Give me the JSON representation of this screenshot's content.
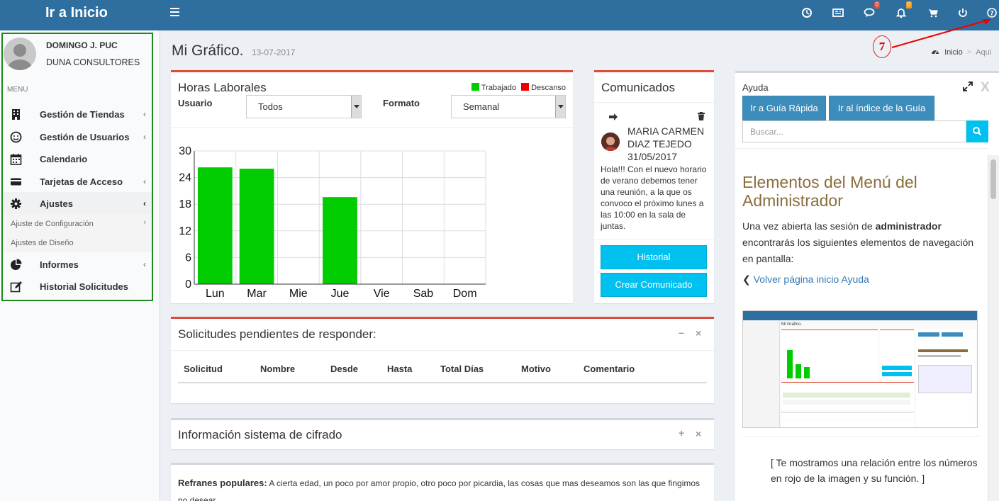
{
  "header": {
    "title": "Ir a Inicio",
    "badges": {
      "messages": "0",
      "notifications": "0"
    }
  },
  "sidebar": {
    "user_name": "DOMINGO J. PUC",
    "user_company": "DUNA CONSULTORES",
    "menu_header": "MENU",
    "items": [
      {
        "label": "Gestión de Tiendas",
        "icon": "building-icon"
      },
      {
        "label": "Gestión de Usuarios",
        "icon": "smile-icon"
      },
      {
        "label": "Calendario",
        "icon": "calendar-icon"
      },
      {
        "label": "Tarjetas de Acceso",
        "icon": "card-icon"
      },
      {
        "label": "Ajustes",
        "icon": "gear-icon"
      },
      {
        "label": "Informes",
        "icon": "pie-chart-icon"
      },
      {
        "label": "Historial Solicitudes",
        "icon": "edit-icon"
      }
    ],
    "submenu": [
      {
        "label": "Ajuste de Configuración"
      },
      {
        "label": "Ajustes de Diseño"
      }
    ]
  },
  "page": {
    "title": "Mi Gráfico.",
    "date": "13-07-2017",
    "breadcrumb_home": "Inicio",
    "breadcrumb_current": "Aqui",
    "callout_number": "7"
  },
  "horas": {
    "title": "Horas Laborales",
    "legend_worked": "Trabajado",
    "legend_rest": "Descanso",
    "usuario_label": "Usuario",
    "usuario_value": "Todos",
    "formato_label": "Formato",
    "formato_value": "Semanal"
  },
  "chart_data": {
    "type": "bar",
    "categories": [
      "Lun",
      "Mar",
      "Mie",
      "Jue",
      "Vie",
      "Sab",
      "Dom"
    ],
    "series": [
      {
        "name": "Trabajado",
        "values": [
          26.3,
          26.0,
          0,
          19.6,
          0,
          0,
          0
        ],
        "color": "#00cc00"
      },
      {
        "name": "Descanso",
        "values": [
          0,
          0,
          0,
          0,
          0,
          0,
          0
        ],
        "color": "#ee0000"
      }
    ],
    "ylim": [
      0,
      30
    ],
    "yticks": [
      0,
      6,
      12,
      18,
      24,
      30
    ],
    "grid": true,
    "legend": "top-right"
  },
  "comunicados": {
    "title": "Comunicados",
    "author": "MARIA CARMEN DIAZ TEJEDO",
    "date": "31/05/2017",
    "text": "Hola!!! Con el nuevo horario de verano debemos tener una reunión, a la que os convoco el próximo lunes a las 10:00 en la sala de juntas.",
    "historial_button": "Historial",
    "crear_button": "Crear Comunicado"
  },
  "solicitudes": {
    "title": "Solicitudes pendientes de responder:",
    "columns": [
      "Solicitud",
      "Nombre",
      "Desde",
      "Hasta",
      "Total Días",
      "Motivo",
      "Comentario"
    ]
  },
  "cifrado": {
    "title": "Información sistema de cifrado"
  },
  "refranes": {
    "label": "Refranes populares:",
    "text": "A cierta edad, un poco por amor propio, otro poco por picardia, las cosas que mas deseamos son las que fingimos no desear."
  },
  "ayuda": {
    "title": "Ayuda",
    "close_label": "X",
    "guia_rapida_button": "Ir a Guía Rápida",
    "indice_button": "Ir al índice de la Guía",
    "search_placeholder": "Buscar...",
    "help_title": "Elementos del Menú del Administrador",
    "intro_before": "Una vez abierta las sesión de ",
    "intro_bold": "administrador",
    "intro_after": " encontrarás los siguientes elementos de navegación en pantalla:",
    "back_link": "Volver página inicio Ayuda",
    "note": "[ Te mostramos una relación entre los números en rojo de la imagen y su función. ]",
    "thumb_title": "Mi Gráfico."
  }
}
